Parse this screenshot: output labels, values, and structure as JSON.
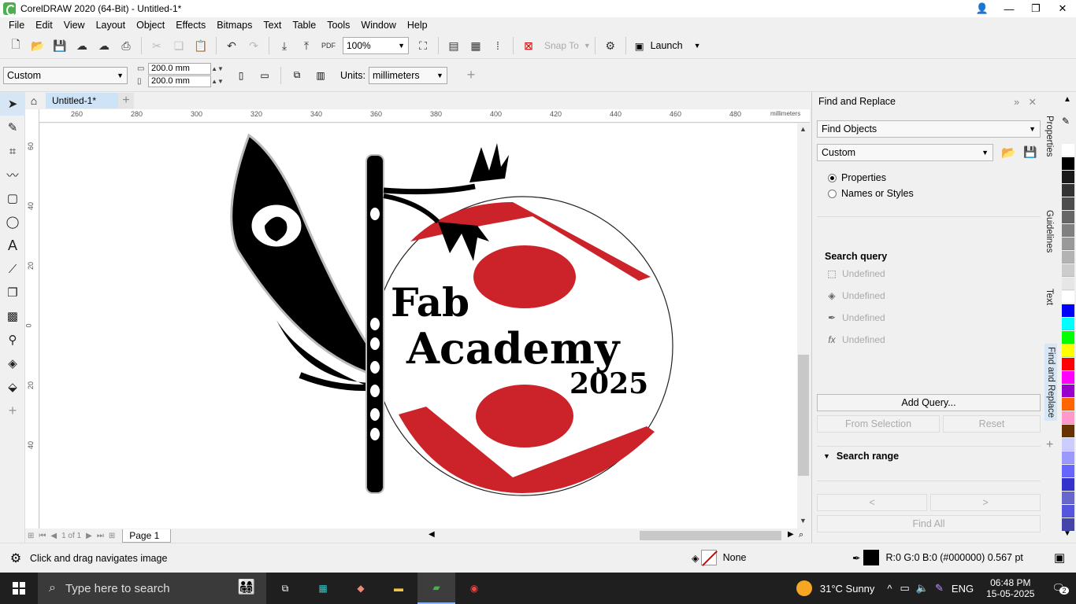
{
  "window": {
    "title": "CorelDRAW 2020 (64-Bit) - Untitled-1*"
  },
  "menu": [
    "File",
    "Edit",
    "View",
    "Layout",
    "Object",
    "Effects",
    "Bitmaps",
    "Text",
    "Table",
    "Tools",
    "Window",
    "Help"
  ],
  "toolbar": {
    "zoom": "100%",
    "snap_to": "Snap To",
    "launch": "Launch",
    "pdf_label": "PDF"
  },
  "property_bar": {
    "page_preset": "Custom",
    "width": "200.0 mm",
    "height": "200.0 mm",
    "units_label": "Units:",
    "units_value": "millimeters"
  },
  "document": {
    "tab": "Untitled-1*"
  },
  "ruler": {
    "h_ticks": [
      "260",
      "280",
      "300",
      "320",
      "340",
      "360",
      "380",
      "400",
      "420",
      "440",
      "460",
      "480"
    ],
    "h_unit": "millimeters",
    "v_ticks": [
      "60",
      "40",
      "20",
      "0",
      "20",
      "40"
    ]
  },
  "artwork": {
    "line1": "Fab",
    "line2": "Academy",
    "line3": "2025"
  },
  "page_nav": {
    "of_text": "1  of  1",
    "page_tab": "Page 1"
  },
  "docker": {
    "title": "Find and Replace",
    "mode": "Find Objects",
    "preset": "Custom",
    "radio_properties": "Properties",
    "radio_names": "Names or Styles",
    "search_query": "Search query",
    "queries": [
      "Undefined",
      "Undefined",
      "Undefined",
      "Undefined"
    ],
    "add_query": "Add Query...",
    "from_selection": "From Selection",
    "reset": "Reset",
    "search_range": "Search range",
    "prev": "<",
    "next": ">",
    "find_all": "Find All"
  },
  "vertical_tabs": [
    "Properties",
    "Guidelines",
    "Text",
    "Find and Replace"
  ],
  "palette": [
    "#ffffff",
    "#000000",
    "#1a1a1a",
    "#333333",
    "#4d4d4d",
    "#666666",
    "#808080",
    "#999999",
    "#b3b3b3",
    "#cccccc",
    "#e6e6e6",
    "#ffffff",
    "#0000ff",
    "#00ffff",
    "#00ff00",
    "#ffff00",
    "#ff0000",
    "#ff00ff",
    "#9900cc",
    "#ff6600",
    "#ff99cc",
    "#663300",
    "#ccccff",
    "#9999ff",
    "#6666ff",
    "#3333cc",
    "#6666cc",
    "#5555dd",
    "#4444aa"
  ],
  "status": {
    "hint": "Click and drag navigates image",
    "fill": "None",
    "outline": "R:0 G:0 B:0 (#000000)  0.567 pt"
  },
  "taskbar": {
    "search": "Type here to search",
    "weather": "31°C  Sunny",
    "lang": "ENG",
    "time": "06:48 PM",
    "date": "15-05-2025",
    "notif": "2"
  }
}
